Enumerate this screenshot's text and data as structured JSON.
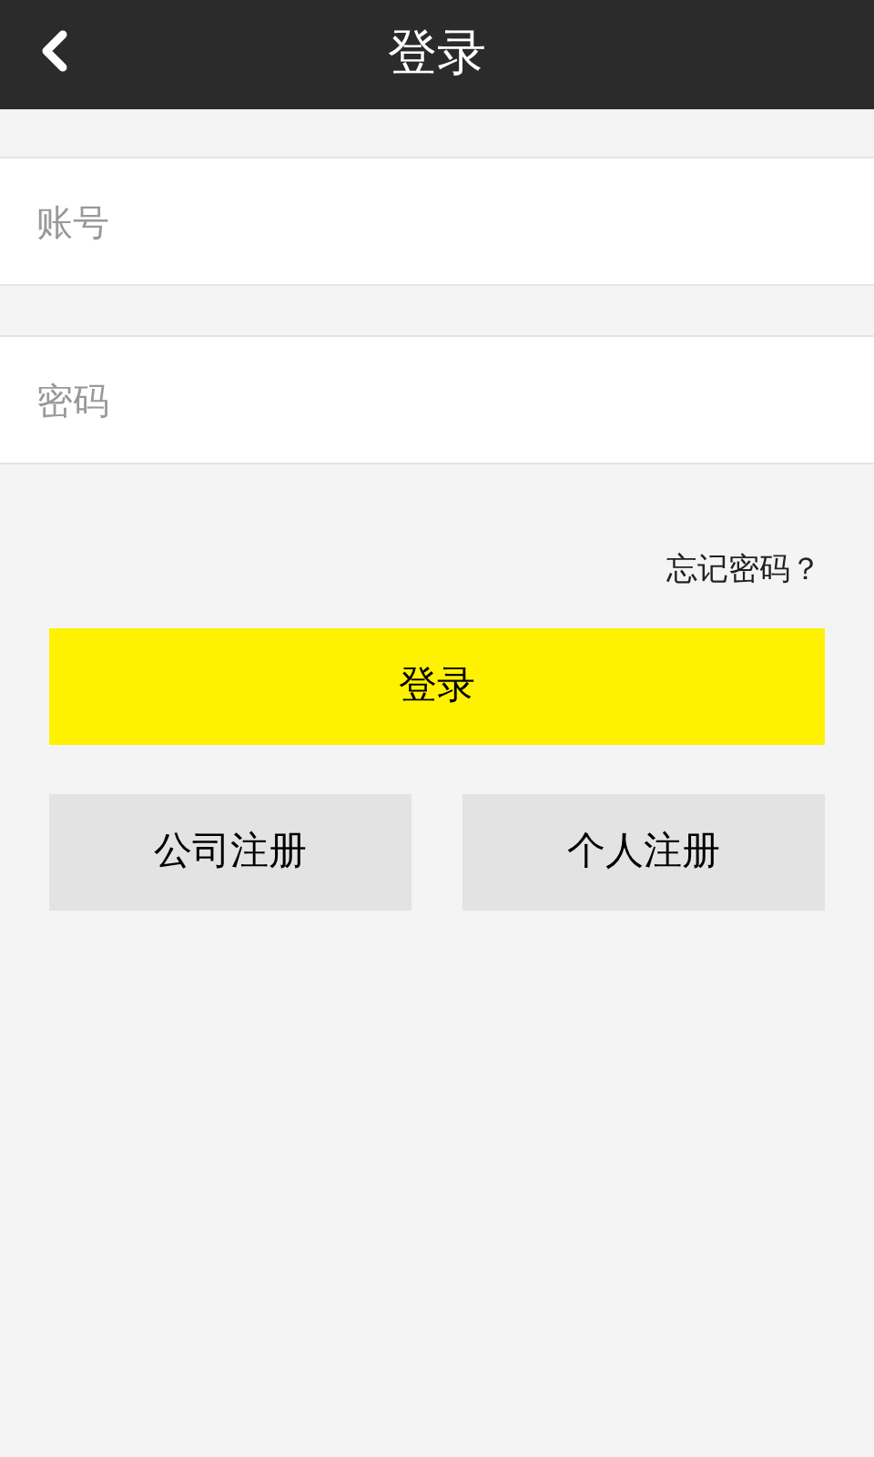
{
  "header": {
    "title": "登录"
  },
  "fields": [
    {
      "placeholder": "账号"
    },
    {
      "placeholder": "密码"
    }
  ],
  "forgot_link": "忘记密码？",
  "login_button": "登录",
  "register_buttons": [
    "公司注册",
    "个人注册"
  ]
}
